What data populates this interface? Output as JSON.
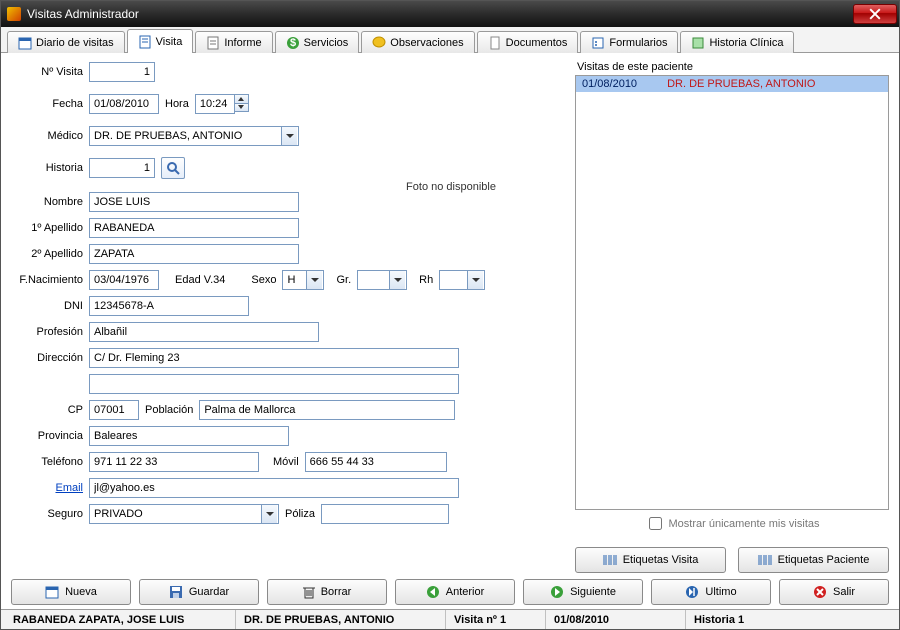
{
  "window": {
    "title": "Visitas Administrador"
  },
  "tabs": [
    {
      "label": "Diario de visitas",
      "icon": "calendar-icon"
    },
    {
      "label": "Visita",
      "icon": "form-icon",
      "active": true
    },
    {
      "label": "Informe",
      "icon": "report-icon"
    },
    {
      "label": "Servicios",
      "icon": "dollar-icon"
    },
    {
      "label": "Observaciones",
      "icon": "comment-icon"
    },
    {
      "label": "Documentos",
      "icon": "document-icon"
    },
    {
      "label": "Formularios",
      "icon": "forms-icon"
    },
    {
      "label": "Historia Clínica",
      "icon": "history-icon"
    }
  ],
  "form": {
    "labels": {
      "n_visita": "Nº Visita",
      "fecha": "Fecha",
      "hora": "Hora",
      "medico": "Médico",
      "historia": "Historia",
      "nombre": "Nombre",
      "apellido1": "1º Apellido",
      "apellido2": "2º Apellido",
      "fnacimiento": "F.Nacimiento",
      "edad": "Edad V.34",
      "sexo": "Sexo",
      "gr": "Gr.",
      "rh": "Rh",
      "dni": "DNI",
      "profesion": "Profesión",
      "direccion": "Dirección",
      "cp": "CP",
      "poblacion": "Población",
      "provincia": "Provincia",
      "telefono": "Teléfono",
      "movil": "Móvil",
      "email": "Email",
      "seguro": "Seguro",
      "poliza": "Póliza"
    },
    "values": {
      "n_visita": "1",
      "fecha": "01/08/2010",
      "hora": "10:24",
      "medico": "DR. DE PRUEBAS, ANTONIO",
      "historia": "1",
      "nombre": "JOSE LUIS",
      "apellido1": "RABANEDA",
      "apellido2": "ZAPATA",
      "fnacimiento": "03/04/1976",
      "sexo": "H",
      "gr": "",
      "rh": "",
      "dni": "12345678-A",
      "profesion": "Albañil",
      "direccion": "C/ Dr. Fleming 23",
      "direccion2": "",
      "cp": "07001",
      "poblacion": "Palma de Mallorca",
      "provincia": "Baleares",
      "telefono": "971 11 22 33",
      "movil": "666 55 44 33",
      "email": "jl@yahoo.es",
      "seguro": "PRIVADO",
      "poliza": ""
    },
    "photo_placeholder": "Foto no disponible"
  },
  "side": {
    "header": "Visitas de este paciente",
    "visits": [
      {
        "date": "01/08/2010",
        "doctor": "DR. DE PRUEBAS, ANTONIO"
      }
    ],
    "only_mine": "Mostrar únicamente mis visitas",
    "etq_visita": "Etiquetas Visita",
    "etq_paciente": "Etiquetas Paciente"
  },
  "buttons": {
    "nueva": "Nueva",
    "guardar": "Guardar",
    "borrar": "Borrar",
    "anterior": "Anterior",
    "siguiente": "Siguiente",
    "ultimo": "Ultimo",
    "salir": "Salir"
  },
  "status": {
    "patient": "RABANEDA ZAPATA, JOSE LUIS",
    "doctor": "DR. DE PRUEBAS, ANTONIO",
    "visita": "Visita nº 1",
    "fecha": "01/08/2010",
    "historia": "Historia 1"
  }
}
